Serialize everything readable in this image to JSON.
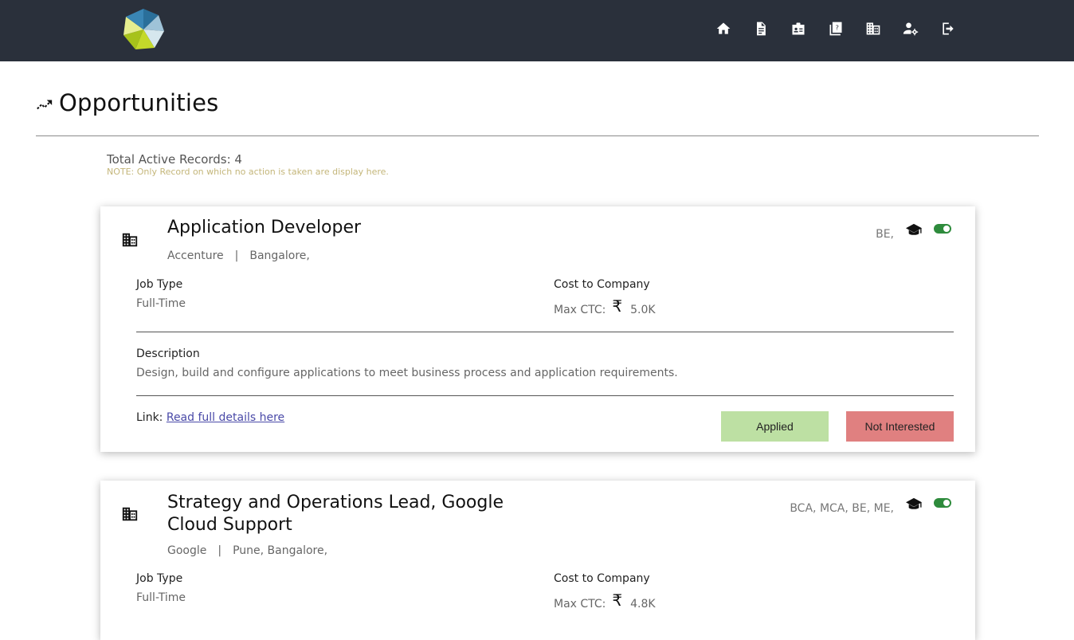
{
  "nav": {
    "icons": [
      "home-icon",
      "file-icon",
      "id-card-icon",
      "quiz-icon",
      "building-icon",
      "user-settings-icon",
      "logout-icon"
    ]
  },
  "page": {
    "title": "Opportunities",
    "total_records": "Total Active Records: 4",
    "note": "NOTE: Only Record on which no action is taken are display here."
  },
  "labels": {
    "job_type": "Job Type",
    "cost_to_company": "Cost to Company",
    "max_ctc": "Max CTC:",
    "rupee": "₹",
    "description": "Description",
    "link": "Link:",
    "link_text": "Read full details here",
    "separator": "|",
    "applied": "Applied",
    "not_interested": "Not Interested"
  },
  "jobs": [
    {
      "title": "Application Developer",
      "company": "Accenture",
      "locations": "Bangalore,",
      "qualifications": "BE,",
      "job_type": "Full-Time",
      "max_ctc": "5.0K",
      "description": "Design, build and configure applications to meet business process and application requirements.",
      "active": true
    },
    {
      "title": "Strategy and Operations Lead, Google Cloud Support",
      "company": "Google",
      "locations": "Pune, Bangalore,",
      "qualifications": "BCA, MCA, BE, ME,",
      "job_type": "Full-Time",
      "max_ctc": "4.8K",
      "active": true
    }
  ],
  "colors": {
    "topbar": "#2a303b",
    "applied_button": "#bde0a3",
    "not_interested_button": "#e08080",
    "toggle_on": "#2e8b3c",
    "note_text": "#c4b67a"
  }
}
